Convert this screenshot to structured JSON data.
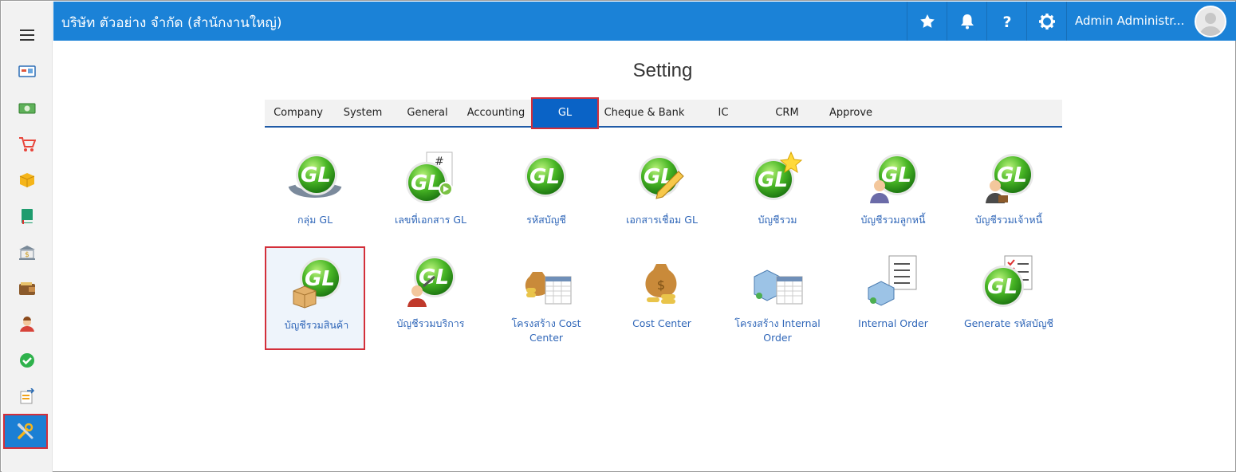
{
  "header": {
    "company": "บริษัท ตัวอย่าง จำกัด (สำนักงานใหญ่)",
    "user_name": "Admin Administr..."
  },
  "sidebar": {
    "items": [
      {
        "icon": "dashboard-icon"
      },
      {
        "icon": "money-icon"
      },
      {
        "icon": "cart-icon"
      },
      {
        "icon": "box-icon"
      },
      {
        "icon": "book-icon"
      },
      {
        "icon": "bank-icon"
      },
      {
        "icon": "wallet-icon"
      },
      {
        "icon": "person-icon"
      },
      {
        "icon": "check-icon"
      },
      {
        "icon": "transfer-icon"
      },
      {
        "icon": "tools-icon",
        "active": true
      }
    ]
  },
  "page": {
    "title": "Setting"
  },
  "tabs": [
    {
      "label": "Company"
    },
    {
      "label": "System"
    },
    {
      "label": "General"
    },
    {
      "label": "Accounting"
    },
    {
      "label": "GL",
      "active": true
    },
    {
      "label": "Cheque & Bank"
    },
    {
      "label": "IC"
    },
    {
      "label": "CRM"
    },
    {
      "label": "Approve"
    }
  ],
  "tiles": [
    {
      "label": "กลุ่ม GL",
      "icon": "gl-group-icon"
    },
    {
      "label": "เลขที่เอกสาร GL",
      "icon": "gl-docnumber-icon"
    },
    {
      "label": "รหัสบัญชี",
      "icon": "gl-account-code-icon"
    },
    {
      "label": "เอกสารเชื่อม GL",
      "icon": "gl-link-document-icon"
    },
    {
      "label": "บัญชีรวม",
      "icon": "gl-control-account-icon"
    },
    {
      "label": "บัญชีรวมลูกหนี้",
      "icon": "gl-debtor-account-icon"
    },
    {
      "label": "บัญชีรวมเจ้าหนี้",
      "icon": "gl-creditor-account-icon"
    },
    {
      "label": "บัญชีรวมสินค้า",
      "icon": "gl-inventory-account-icon",
      "selected": true
    },
    {
      "label": "บัญชีรวมบริการ",
      "icon": "gl-service-account-icon"
    },
    {
      "label": "โครงสร้าง Cost Center",
      "icon": "cost-center-structure-icon"
    },
    {
      "label": "Cost Center",
      "icon": "cost-center-icon"
    },
    {
      "label": "โครงสร้าง Internal Order",
      "icon": "internal-order-structure-icon"
    },
    {
      "label": "Internal Order",
      "icon": "internal-order-icon"
    },
    {
      "label": "Generate รหัสบัญชี",
      "icon": "generate-account-code-icon"
    }
  ],
  "colors": {
    "header_bg": "#1b82d7",
    "active_tab_bg": "#0a63c6",
    "highlight_border": "#d32f3a",
    "tile_label": "#2f66b8"
  }
}
